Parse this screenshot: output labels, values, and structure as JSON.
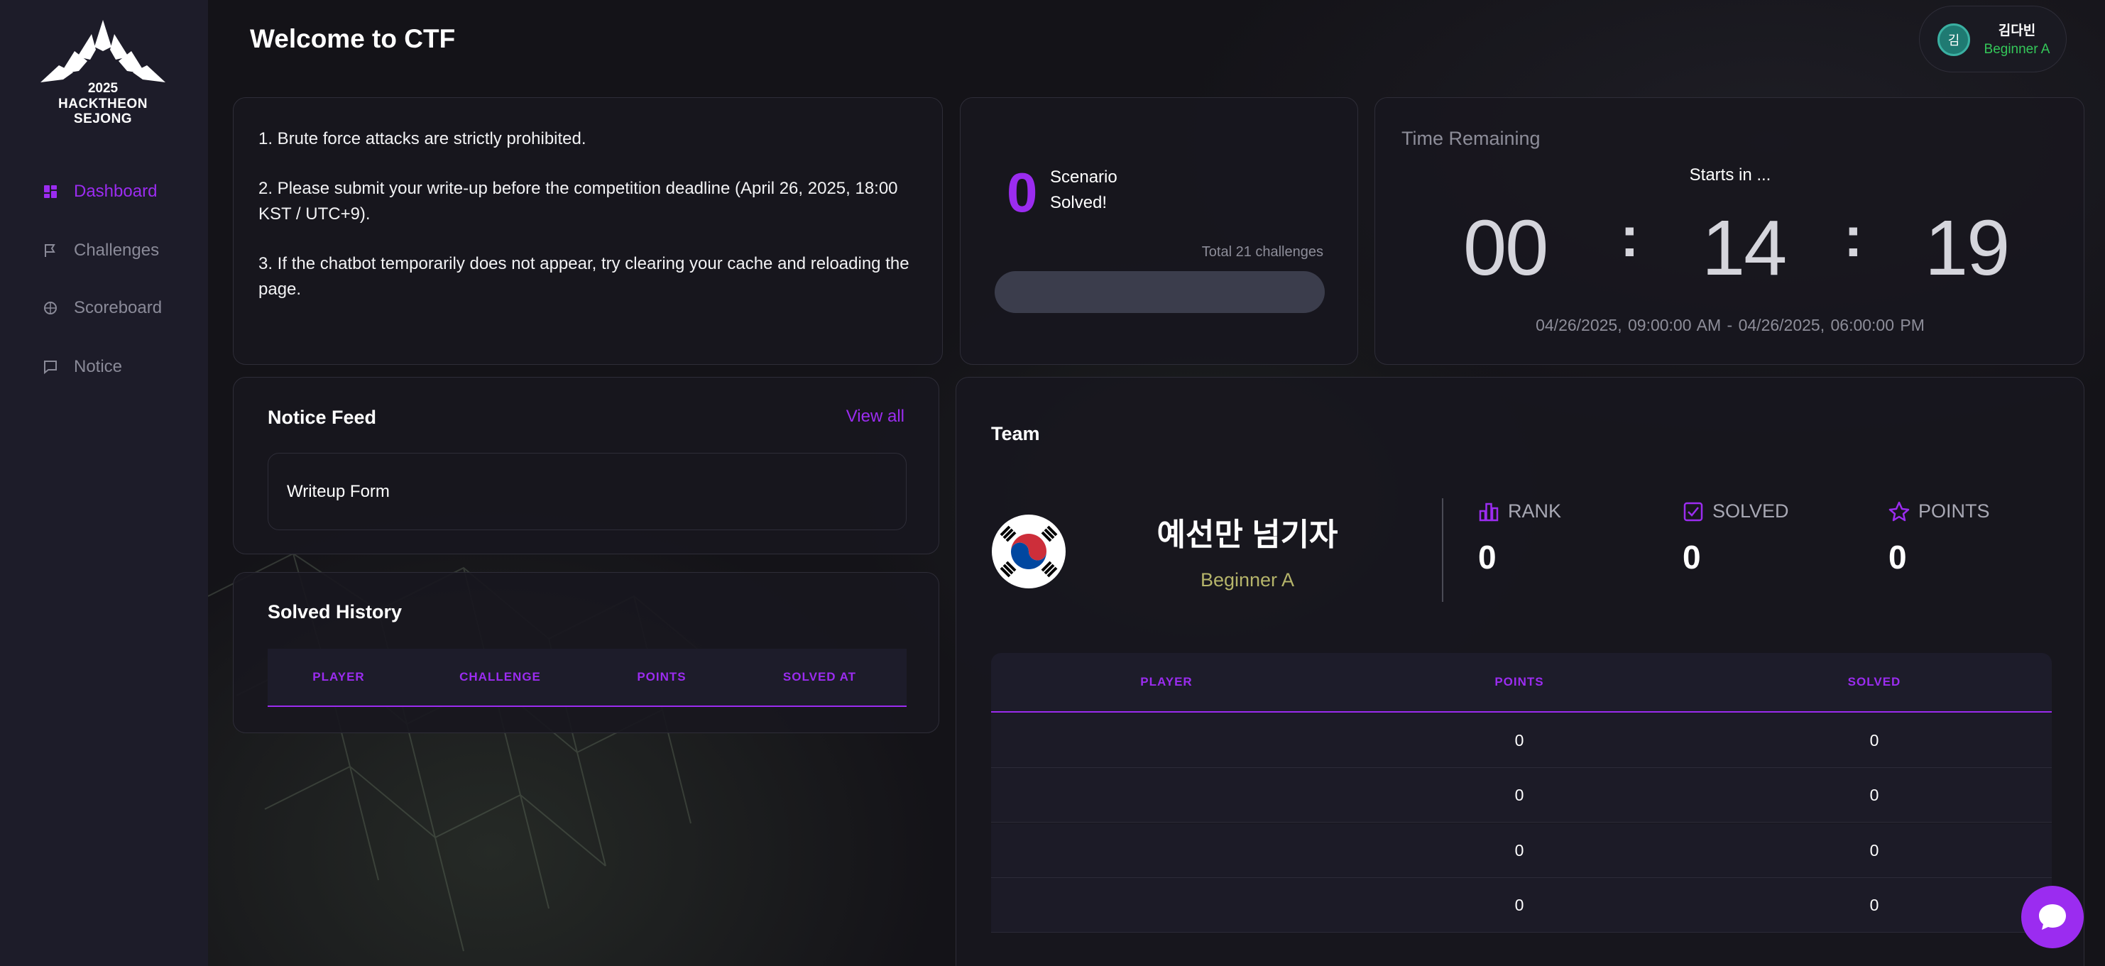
{
  "colors": {
    "accent": "#9b2cf0",
    "sidebar": "#1d1c29",
    "card": "#18171e",
    "role_green": "#34c759",
    "team_role": "#b5b46a"
  },
  "brand": {
    "year": "2025",
    "line1": "HACKTHEON",
    "line2": "SEJONG"
  },
  "sidebar": {
    "items": [
      {
        "label": "Dashboard",
        "icon": "dashboard-icon",
        "active": true
      },
      {
        "label": "Challenges",
        "icon": "flag-icon",
        "active": false
      },
      {
        "label": "Scoreboard",
        "icon": "scoreboard-icon",
        "active": false
      },
      {
        "label": "Notice",
        "icon": "message-icon",
        "active": false
      }
    ]
  },
  "header": {
    "title": "Welcome to CTF"
  },
  "user": {
    "avatar_text": "김",
    "name": "김다빈",
    "role": "Beginner A"
  },
  "rules": [
    "1. Brute force attacks are strictly prohibited.",
    "2. Please submit your write-up before the competition deadline (April 26, 2025, 18:00 KST / UTC+9).",
    "3. If the chatbot temporarily does not appear, try clearing your cache and reloading the page."
  ],
  "scenario": {
    "count": "0",
    "label_line1": "Scenario",
    "label_line2": "Solved!",
    "total": "Total 21 challenges",
    "progress": 0
  },
  "timer": {
    "title": "Time Remaining",
    "starts": "Starts in ...",
    "hours": "00",
    "minutes": "14",
    "seconds": "19",
    "sep": ":",
    "start_date": "04/26/2025, 09:00:00 AM",
    "dash": "-",
    "end_date": "04/26/2025, 06:00:00 PM"
  },
  "notice": {
    "title": "Notice Feed",
    "view_all": "View all",
    "items": [
      "Writeup Form"
    ]
  },
  "solved_history": {
    "title": "Solved History",
    "columns": [
      "PLAYER",
      "CHALLENGE",
      "POINTS",
      "SOLVED AT"
    ]
  },
  "team": {
    "title": "Team",
    "name": "예선만 넘기자",
    "division": "Beginner A",
    "stats": [
      {
        "label": "RANK",
        "icon": "rank-icon",
        "value": "0"
      },
      {
        "label": "SOLVED",
        "icon": "check-square-icon",
        "value": "0"
      },
      {
        "label": "POINTS",
        "icon": "star-icon",
        "value": "0"
      }
    ],
    "columns": [
      "PLAYER",
      "POINTS",
      "SOLVED"
    ],
    "rows": [
      {
        "player": "",
        "points": "0",
        "solved": "0"
      },
      {
        "player": "",
        "points": "0",
        "solved": "0"
      },
      {
        "player": "",
        "points": "0",
        "solved": "0"
      },
      {
        "player": "",
        "points": "0",
        "solved": "0"
      }
    ]
  },
  "chat": {
    "icon": "chat-bubble-icon"
  }
}
